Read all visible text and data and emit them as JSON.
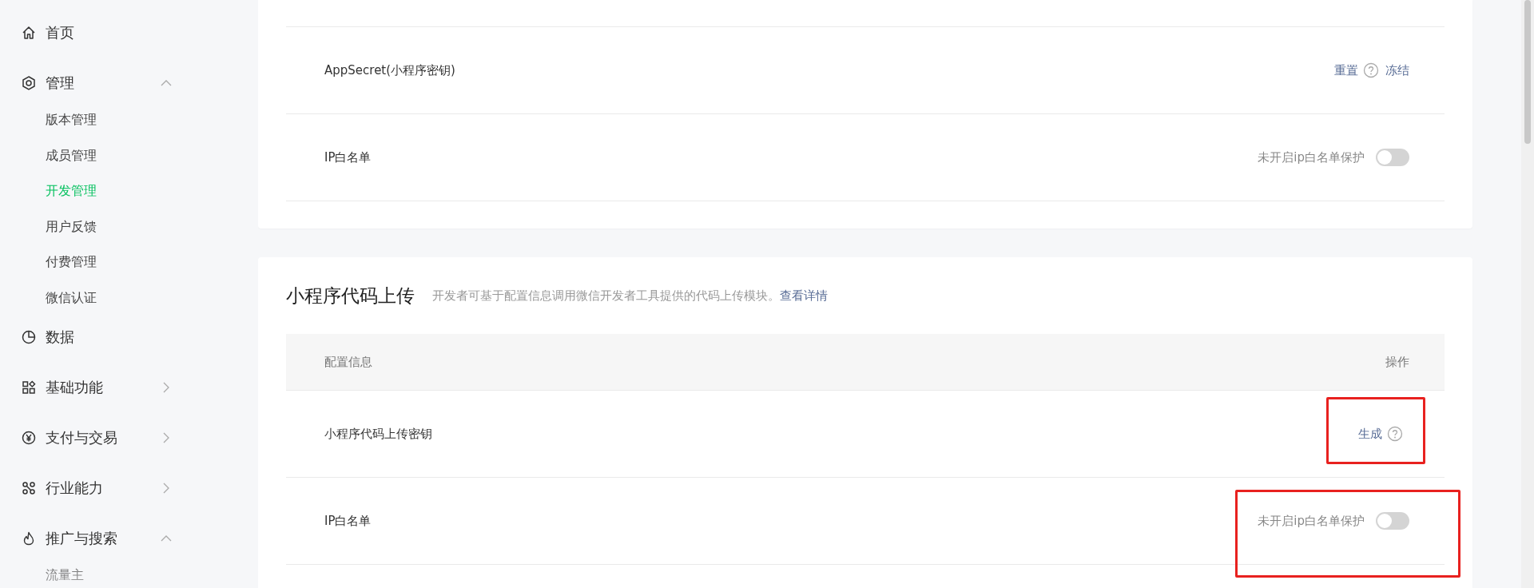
{
  "sidebar": {
    "items": [
      {
        "label": "首页"
      },
      {
        "label": "管理",
        "expanded": true,
        "children": [
          {
            "label": "版本管理",
            "selected": false
          },
          {
            "label": "成员管理",
            "selected": false
          },
          {
            "label": "开发管理",
            "selected": true
          },
          {
            "label": "用户反馈",
            "selected": false
          },
          {
            "label": "付费管理",
            "selected": false
          },
          {
            "label": "微信认证",
            "selected": false
          }
        ]
      },
      {
        "label": "数据"
      },
      {
        "label": "基础功能",
        "expanded": false
      },
      {
        "label": "支付与交易",
        "expanded": false
      },
      {
        "label": "行业能力",
        "expanded": false
      },
      {
        "label": "推广与搜索",
        "expanded": true,
        "children": [
          {
            "label": "流量主",
            "selected": false
          }
        ]
      }
    ]
  },
  "cards": [
    {
      "rows": [
        {
          "label": "AppSecret(小程序密钥)",
          "kind": "actions",
          "highlighted": false,
          "actions": [
            {
              "label": "重置",
              "help": true
            },
            {
              "label": "冻结",
              "help": false
            }
          ]
        },
        {
          "label": "IP白名单",
          "kind": "toggle",
          "highlighted": false,
          "status": "未开启ip白名单保护",
          "on": false
        }
      ]
    },
    {
      "title": "小程序代码上传",
      "description": "开发者可基于配置信息调用微信开发者工具提供的代码上传模块。",
      "link": "查看详情",
      "columns": [
        "配置信息",
        "操作"
      ],
      "rows": [
        {
          "label": "小程序代码上传密钥",
          "kind": "actions",
          "highlighted": true,
          "actions": [
            {
              "label": "生成",
              "help": true
            }
          ]
        },
        {
          "label": "IP白名单",
          "kind": "toggle",
          "highlighted": true,
          "status": "未开启ip白名单保护",
          "on": false
        }
      ]
    }
  ]
}
